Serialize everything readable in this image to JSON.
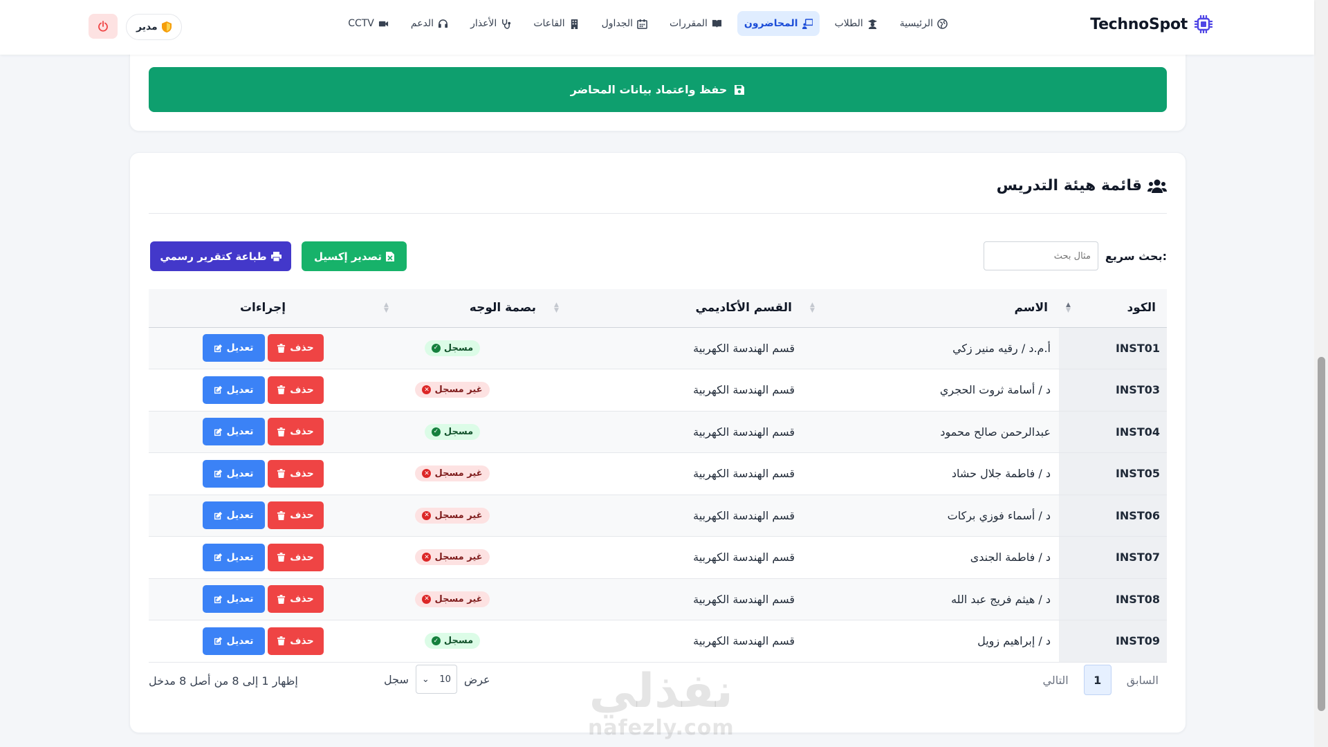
{
  "brand": {
    "name": "TechnoSpot"
  },
  "nav": {
    "items": [
      {
        "label": "الرئيسية",
        "icon": "globe-icon",
        "active": false
      },
      {
        "label": "الطلاب",
        "icon": "graduate-icon",
        "active": false
      },
      {
        "label": "المحاضرون",
        "icon": "chalkboard-teacher-icon",
        "active": true
      },
      {
        "label": "المقررات",
        "icon": "book-icon",
        "active": false
      },
      {
        "label": "الجداول",
        "icon": "calendar-icon",
        "active": false
      },
      {
        "label": "القاعات",
        "icon": "building-icon",
        "active": false
      },
      {
        "label": "الأعذار",
        "icon": "stethoscope-icon",
        "active": false
      },
      {
        "label": "الدعم",
        "icon": "headset-icon",
        "active": false
      },
      {
        "label": "CCTV",
        "icon": "video-camera-icon",
        "active": false
      }
    ],
    "user_label": "مدير"
  },
  "save_button": {
    "label": "حفظ واعتماد بيانات المحاضر"
  },
  "faculty": {
    "title": "قائمة هيئة التدريس",
    "search_label": "بحث سريع:",
    "search_placeholder": "مثال بحث",
    "export_excel_label": "تصدير إكسيل",
    "print_label": "طباعة كتقرير رسمي",
    "columns": [
      "الكود",
      "الاسم",
      "القسم الأكاديمي",
      "بصمة الوجه",
      "إجراءات"
    ],
    "edit_label": "تعديل",
    "delete_label": "حذف",
    "rows": [
      {
        "code": "INST01",
        "name": "أ.م.د / رقيه منير زكي",
        "dept": "قسم الهندسة الكهربية",
        "face": "مسجل",
        "registered": true
      },
      {
        "code": "INST03",
        "name": "د / أسامة ثروت الحجري",
        "dept": "قسم الهندسة الكهربية",
        "face": "غير مسجل",
        "registered": false
      },
      {
        "code": "INST04",
        "name": "عبدالرحمن صالح محمود",
        "dept": "قسم الهندسة الكهربية",
        "face": "مسجل",
        "registered": true
      },
      {
        "code": "INST05",
        "name": "د / فاطمة جلال حشاد",
        "dept": "قسم الهندسة الكهربية",
        "face": "غير مسجل",
        "registered": false
      },
      {
        "code": "INST06",
        "name": "د / أسماء فوزي بركات",
        "dept": "قسم الهندسة الكهربية",
        "face": "غير مسجل",
        "registered": false
      },
      {
        "code": "INST07",
        "name": "د / فاطمة الجندى",
        "dept": "قسم الهندسة الكهربية",
        "face": "غير مسجل",
        "registered": false
      },
      {
        "code": "INST08",
        "name": "د / هيثم فريج عبد الله",
        "dept": "قسم الهندسة الكهربية",
        "face": "غير مسجل",
        "registered": false
      },
      {
        "code": "INST09",
        "name": "د / إبراهيم زويل",
        "dept": "قسم الهندسة الكهربية",
        "face": "مسجل",
        "registered": true
      }
    ],
    "pagination": {
      "prev": "السابق",
      "current": "1",
      "next": "التالي"
    },
    "length": {
      "show_label": "عرض",
      "value": "10",
      "records_label": "سجل"
    },
    "info": "إظهار 1 إلى 8 من أصل 8 مدخل"
  },
  "watermark": {
    "arabic": "نفذلي",
    "latin": "nafezly.com"
  },
  "colors": {
    "primary": "#1d4ed8",
    "save": "#0e9f6e",
    "excel": "#17b26a",
    "print": "#4338ca",
    "edit": "#3b82f6",
    "delete": "#ef4444"
  }
}
